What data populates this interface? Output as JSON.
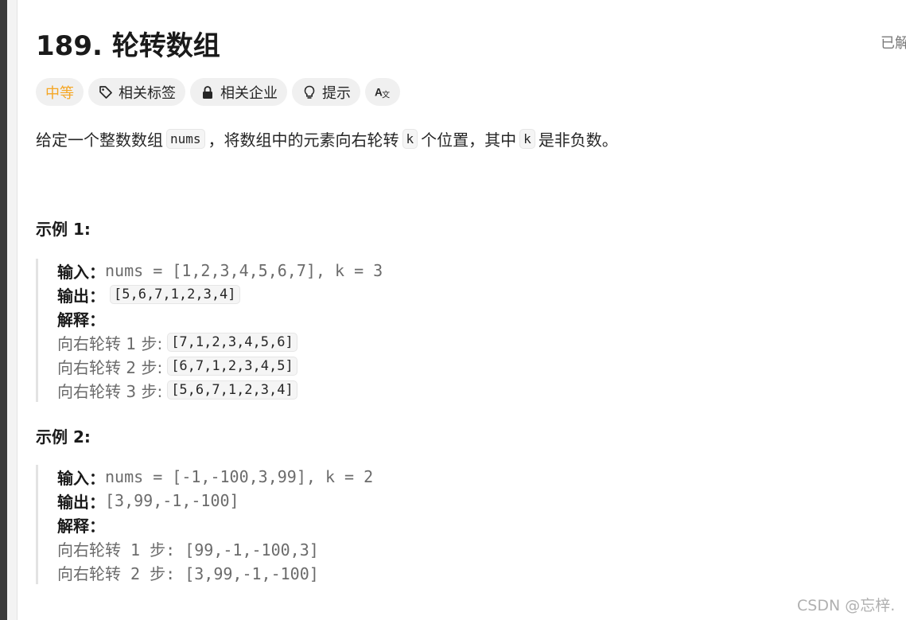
{
  "problem": {
    "title": "189. 轮转数组",
    "solved_label": "已解"
  },
  "tags": [
    {
      "label": "中等",
      "icon": ""
    },
    {
      "label": "相关标签",
      "icon": "tag-icon"
    },
    {
      "label": "相关企业",
      "icon": "lock-icon"
    },
    {
      "label": "提示",
      "icon": "lightbulb-icon"
    },
    {
      "label": "",
      "icon": "translate-icon"
    }
  ],
  "colors": {
    "difficulty": "#f5a623"
  },
  "description": {
    "part1": "给定一个整数数组",
    "code1": "nums",
    "part2": "，将数组中的元素向右轮转",
    "code2": "k",
    "part3": "个位置，其中",
    "code3": "k",
    "part4": "是非负数。"
  },
  "example1": {
    "title": "示例 1:",
    "input_label": "输入：",
    "input_value": "nums = [1,2,3,4,5,6,7], k = 3",
    "output_label": "输出：",
    "output_value": "[5,6,7,1,2,3,4]",
    "explain_label": "解释：",
    "steps": [
      {
        "text": "向右轮转 1 步:",
        "value": "[7,1,2,3,4,5,6]"
      },
      {
        "text": "向右轮转 2 步:",
        "value": "[6,7,1,2,3,4,5]"
      },
      {
        "text": "向右轮转 3 步:",
        "value": "[5,6,7,1,2,3,4]"
      }
    ]
  },
  "example2": {
    "title": "示例 2:",
    "input_label": "输入：",
    "input_value": "nums = [-1,-100,3,99], k = 2",
    "output_label": "输出：",
    "output_value": "[3,99,-1,-100]",
    "explain_label": "解释：",
    "steps": [
      {
        "text": "向右轮转 1 步: [99,-1,-100,3]"
      },
      {
        "text": "向右轮转 2 步: [3,99,-1,-100]"
      }
    ]
  },
  "watermark": "CSDN @忘梓."
}
